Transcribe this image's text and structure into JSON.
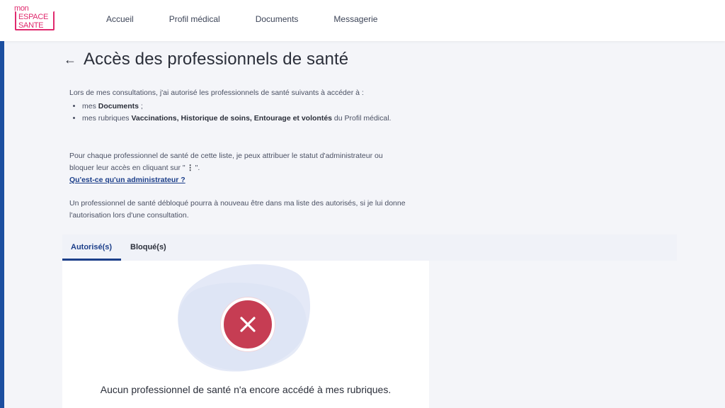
{
  "logo": {
    "line1": "mon",
    "line2": "ESPACE",
    "line3": "SANTE"
  },
  "nav": {
    "items": [
      "Accueil",
      "Profil médical",
      "Documents",
      "Messagerie"
    ]
  },
  "page": {
    "back_icon": "arrow-left-icon",
    "title": "Accès des professionnels de santé"
  },
  "intro": {
    "lead": "Lors de mes consultations, j'ai autorisé les professionnels de santé suivants à accéder à :",
    "item1_prefix": "mes ",
    "item1_bold": "Documents",
    "item1_suffix": " ;",
    "item2_prefix": "mes rubriques ",
    "item2_bold": "Vaccinations, Historique de soins, Entourage et volontés",
    "item2_suffix": " du Profil médical."
  },
  "para2": {
    "text_before": "Pour chaque professionnel de santé de cette liste, je peux attribuer le statut d'administrateur ou bloquer leur accès en cliquant sur \"",
    "kebab": "⋮",
    "text_after": "\"."
  },
  "help_link": "Qu'est-ce qu'un administrateur ?",
  "para3": "Un professionnel de santé débloqué pourra à nouveau être dans ma liste des autorisés, si je lui donne l'autorisation lors d'une consultation.",
  "tabs": [
    {
      "label": "Autorisé(s)",
      "active": true
    },
    {
      "label": "Bloqué(s)",
      "active": false
    }
  ],
  "empty_state": {
    "icon": "close-circle-icon",
    "message": "Aucun professionnel de santé n'a encore accédé à mes rubriques."
  },
  "colors": {
    "brand_pink": "#e02a6e",
    "primary_blue": "#1c3f8a",
    "error_red": "#c63d53",
    "blob_blue": "#e4e9f7"
  }
}
